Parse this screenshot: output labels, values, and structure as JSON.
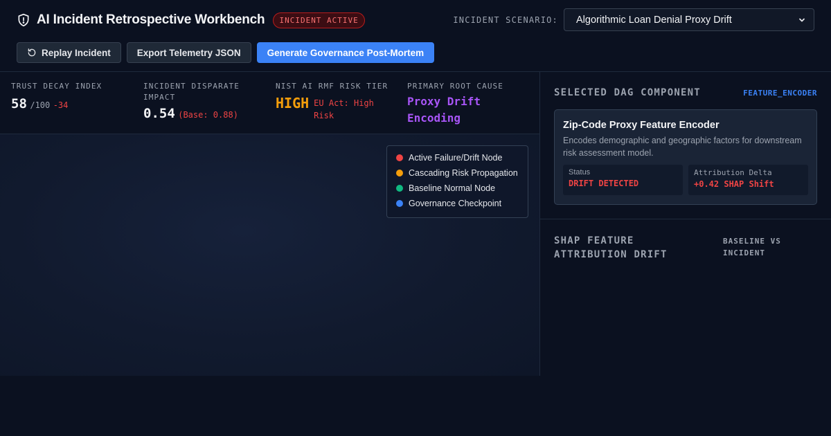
{
  "header": {
    "title": "AI Incident Retrospective Workbench",
    "badge": "INCIDENT ACTIVE",
    "scenario_label": "INCIDENT SCENARIO:",
    "scenario_selected": "Algorithmic Loan Denial Proxy Drift",
    "buttons": {
      "replay": "Replay Incident",
      "export": "Export Telemetry JSON",
      "postmortem": "Generate Governance Post-Mortem"
    }
  },
  "metrics": {
    "trust": {
      "label": "TRUST DECAY INDEX",
      "value": "58",
      "suffix": "/100",
      "delta": "-34"
    },
    "disparate": {
      "label": "INCIDENT DISPARATE IMPACT",
      "value": "0.54",
      "base": "(Base: 0.88)"
    },
    "risk": {
      "label": "NIST AI RMF RISK TIER",
      "value": "HIGH",
      "note": "EU Act: High Risk"
    },
    "root": {
      "label": "PRIMARY ROOT CAUSE",
      "value": "Proxy Drift Encoding"
    }
  },
  "legend": {
    "items": [
      {
        "label": "Active Failure/Drift Node",
        "color": "#ef4444"
      },
      {
        "label": "Cascading Risk Propagation",
        "color": "#f59e0b"
      },
      {
        "label": "Baseline Normal Node",
        "color": "#10b981"
      },
      {
        "label": "Governance Checkpoint",
        "color": "#3b82f6"
      }
    ]
  },
  "selected": {
    "title": "SELECTED DAG COMPONENT",
    "tag": "FEATURE_ENCODER",
    "card_title": "Zip-Code Proxy Feature Encoder",
    "card_desc": "Encodes demographic and geographic factors for downstream risk assessment model.",
    "status_label": "Status",
    "status_value": "DRIFT DETECTED",
    "delta_label": "Attribution Delta",
    "delta_value": "+0.42 SHAP Shift"
  },
  "shap": {
    "title": "SHAP FEATURE ATTRIBUTION DRIFT",
    "subtitle": "BASELINE VS INCIDENT"
  },
  "icons": {
    "title_icon": "shield-icon",
    "replay_icon": "rotate-ccw-icon",
    "select_icon": "chevron-down-icon"
  },
  "colors": {
    "accent": "#3b82f6",
    "danger": "#ef4444",
    "warning": "#f59e0b",
    "purple": "#a855f7"
  }
}
